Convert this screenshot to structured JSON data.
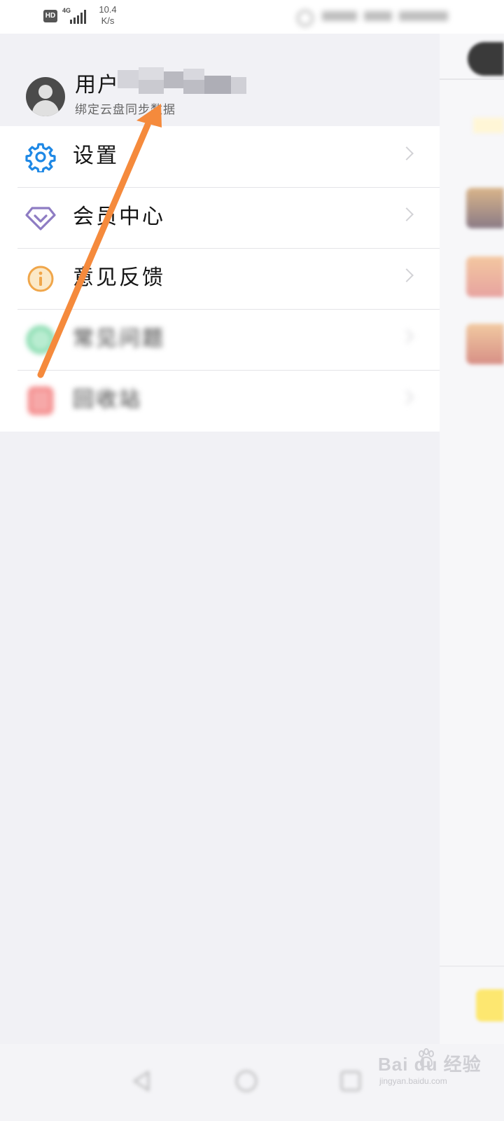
{
  "status_bar": {
    "hd_label": "HD",
    "network_type": "4G",
    "speed_value": "10.4",
    "speed_unit": "K/s"
  },
  "profile": {
    "username": "用户",
    "subtitle": "绑定云盘同步数据"
  },
  "menu": {
    "items": [
      {
        "label": "设置",
        "icon": "gear-icon",
        "color": "#1e88e5",
        "blurred": false
      },
      {
        "label": "会员中心",
        "icon": "diamond-icon",
        "color": "#8e7cc3",
        "blurred": false
      },
      {
        "label": "意见反馈",
        "icon": "info-icon",
        "color": "#f0a64a",
        "blurred": false
      },
      {
        "label": "常见问题",
        "icon": "help-icon",
        "color": "#3cc47c",
        "blurred": true
      },
      {
        "label": "回收站",
        "icon": "trash-icon",
        "color": "#f05a5a",
        "blurred": true
      }
    ]
  },
  "watermark": {
    "brand": "Bai du 经验",
    "url": "jingyan.baidu.com"
  },
  "colors": {
    "annotation_arrow": "#f58a3c",
    "drawer_bg": "#f1f1f5",
    "menu_bg": "#ffffff"
  }
}
